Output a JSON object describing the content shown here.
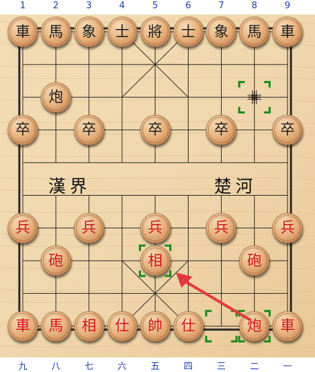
{
  "top_file_numbers": [
    "1",
    "2",
    "3",
    "4",
    "5",
    "6",
    "7",
    "8",
    "9"
  ],
  "bottom_file_numbers": [
    "九",
    "八",
    "七",
    "六",
    "五",
    "四",
    "三",
    "二",
    "一"
  ],
  "river": {
    "left_text": "漢界",
    "right_text": "楚河"
  },
  "colors": {
    "board": "#f0d7ad",
    "line": "#2a2a2a",
    "red_text": "#d4121c",
    "black_text": "#1b1b1b",
    "file_label": "#1a3fa8",
    "selection": "#1a8a1a",
    "arrow": "#e23a3a"
  },
  "pieces": [
    {
      "char": "車",
      "side": "black",
      "col": 0,
      "row": 0
    },
    {
      "char": "馬",
      "side": "black",
      "col": 1,
      "row": 0
    },
    {
      "char": "象",
      "side": "black",
      "col": 2,
      "row": 0
    },
    {
      "char": "士",
      "side": "black",
      "col": 3,
      "row": 0
    },
    {
      "char": "將",
      "side": "black",
      "col": 4,
      "row": 0
    },
    {
      "char": "士",
      "side": "black",
      "col": 5,
      "row": 0
    },
    {
      "char": "象",
      "side": "black",
      "col": 6,
      "row": 0
    },
    {
      "char": "馬",
      "side": "black",
      "col": 7,
      "row": 0
    },
    {
      "char": "車",
      "side": "black",
      "col": 8,
      "row": 0
    },
    {
      "char": "炮",
      "side": "black",
      "col": 1,
      "row": 2
    },
    {
      "char": "卒",
      "side": "black",
      "col": 0,
      "row": 3
    },
    {
      "char": "卒",
      "side": "black",
      "col": 2,
      "row": 3
    },
    {
      "char": "卒",
      "side": "black",
      "col": 4,
      "row": 3
    },
    {
      "char": "卒",
      "side": "black",
      "col": 6,
      "row": 3
    },
    {
      "char": "卒",
      "side": "black",
      "col": 8,
      "row": 3
    },
    {
      "char": "兵",
      "side": "red",
      "col": 0,
      "row": 6
    },
    {
      "char": "兵",
      "side": "red",
      "col": 2,
      "row": 6
    },
    {
      "char": "兵",
      "side": "red",
      "col": 4,
      "row": 6
    },
    {
      "char": "兵",
      "side": "red",
      "col": 6,
      "row": 6
    },
    {
      "char": "兵",
      "side": "red",
      "col": 8,
      "row": 6
    },
    {
      "char": "砲",
      "side": "red",
      "col": 1,
      "row": 7
    },
    {
      "char": "相",
      "side": "red",
      "col": 4,
      "row": 7
    },
    {
      "char": "砲",
      "side": "red",
      "col": 7,
      "row": 7
    },
    {
      "char": "車",
      "side": "red",
      "col": 0,
      "row": 9
    },
    {
      "char": "馬",
      "side": "red",
      "col": 1,
      "row": 9
    },
    {
      "char": "相",
      "side": "red",
      "col": 2,
      "row": 9
    },
    {
      "char": "仕",
      "side": "red",
      "col": 3,
      "row": 9
    },
    {
      "char": "帥",
      "side": "red",
      "col": 4,
      "row": 9
    },
    {
      "char": "仕",
      "side": "red",
      "col": 5,
      "row": 9
    },
    {
      "char": "炮",
      "side": "red",
      "col": 7,
      "row": 9
    },
    {
      "char": "車",
      "side": "red",
      "col": 8,
      "row": 9
    }
  ],
  "selection_markers": [
    {
      "label": "black-move-target",
      "col": 7,
      "row": 2
    },
    {
      "label": "red-elephant-selected",
      "col": 4,
      "row": 7
    },
    {
      "label": "red-move-origin",
      "col": 6,
      "row": 9
    },
    {
      "label": "red-cannon-selected",
      "col": 7,
      "row": 9
    }
  ],
  "cursor_marker": {
    "col": 7,
    "row": 2
  }
}
